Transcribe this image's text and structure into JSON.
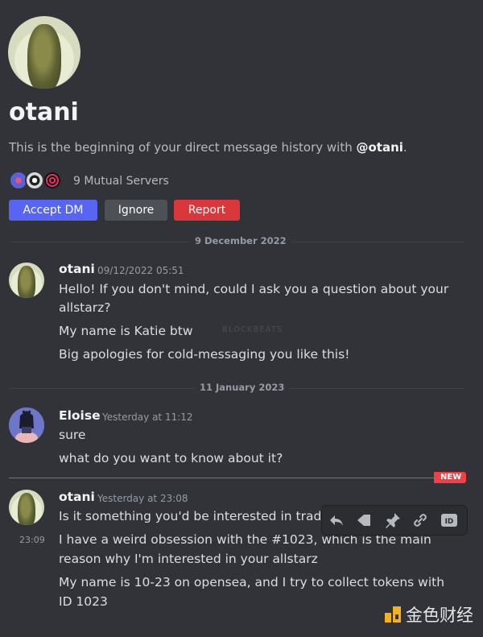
{
  "dm_header": {
    "username": "otani",
    "intro_prefix": "This is the beginning of your direct message history with ",
    "intro_mention": "@otani",
    "intro_suffix": ".",
    "mutual_servers": "9 Mutual Servers",
    "accept_label": "Accept DM",
    "ignore_label": "Ignore",
    "report_label": "Report"
  },
  "dividers": [
    "9 December 2022",
    "11 January 2023"
  ],
  "messages": [
    {
      "author": "otani",
      "timestamp": "09/12/2022 05:51",
      "lines": [
        "Hello! If you don't mind, could I ask you a question about your",
        "allstarz?",
        "My name is Katie btw",
        "Big apologies for cold-messaging you like this!"
      ]
    },
    {
      "author": "Eloise",
      "timestamp": "Yesterday at 11:12",
      "lines": [
        "sure",
        "what do you want to know about it?"
      ]
    },
    {
      "author": "otani",
      "timestamp": "Yesterday at 23:08",
      "hover_time": "23:09",
      "lines": [
        "Is it something you'd be interested in tradin",
        "I have a weird obsession with the #1023, which is the main",
        "reason why I'm interested in your allstarz",
        "My name is 10-23 on opensea, and I try to collect tokens with",
        "ID 1023"
      ]
    }
  ],
  "new_badge": "NEW",
  "toolbar": {
    "icons": [
      "reply-icon",
      "forward-icon",
      "pin-icon",
      "link-icon",
      "id-icon"
    ],
    "id_label": "ID"
  },
  "watermark": {
    "text": "金色财经",
    "faint": "BLOCKBEATS"
  },
  "colors": {
    "background": "#313338",
    "accent": "#5865f2",
    "danger": "#da373c",
    "new_marker": "#f23f43"
  }
}
